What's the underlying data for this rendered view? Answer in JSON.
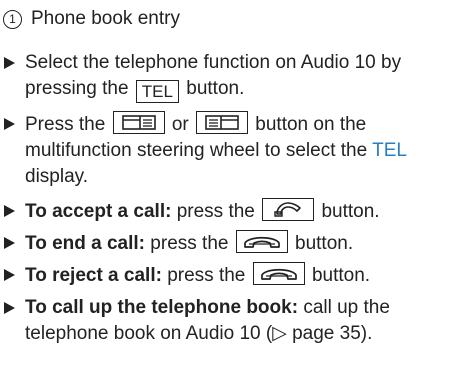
{
  "callout": {
    "number": "1",
    "label": "Phone book entry"
  },
  "steps": [
    {
      "pre": "Select the telephone function on Audio 10 by pressing the",
      "key": "TEL",
      "post": "button."
    },
    {
      "pre": "Press the",
      "mid": "or",
      "post": "button on the multifunction steering wheel to select the",
      "display": "TEL",
      "end": "display.",
      "icon_left": "page-back-icon",
      "icon_right": "page-forward-icon"
    },
    {
      "bold": "To accept a call:",
      "pre": "press the",
      "post": "button.",
      "icon": "phone-accept-icon"
    },
    {
      "bold": "To end a call:",
      "pre": "press the",
      "post": "button.",
      "icon": "phone-hangup-icon"
    },
    {
      "bold": "To reject a call:",
      "pre": "press the",
      "post": "button.",
      "icon": "phone-hangup-icon"
    },
    {
      "bold": "To call up the telephone book:",
      "pre": "call up the telephone book on Audio 10 (",
      "ref": "▷ page 35",
      "post": ")."
    }
  ]
}
